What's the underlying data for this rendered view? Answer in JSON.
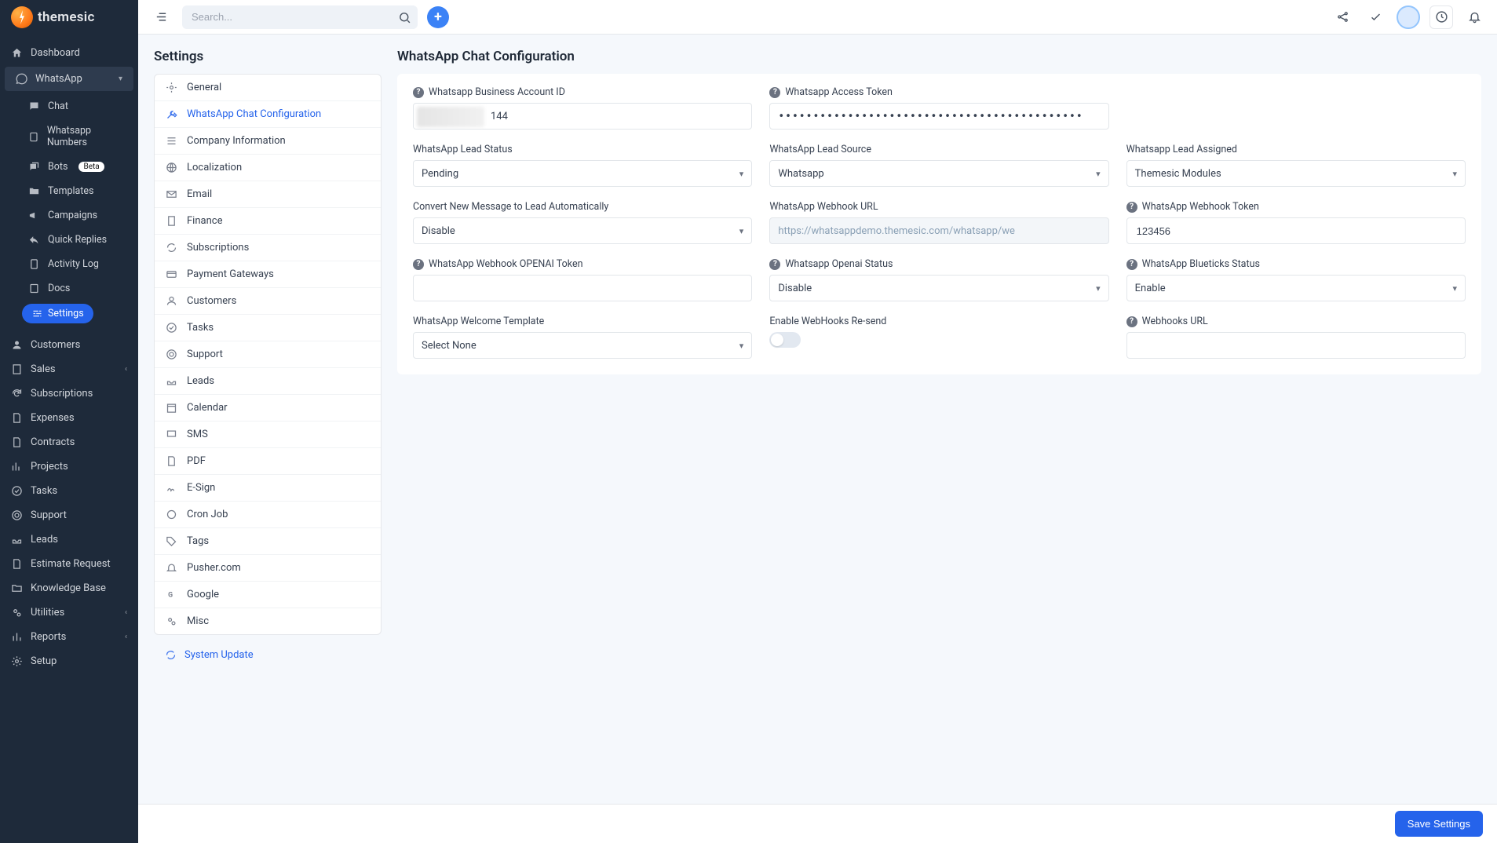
{
  "brand": {
    "name": "themesic"
  },
  "topbar": {
    "search_placeholder": "Search..."
  },
  "sidebar": {
    "items": {
      "dashboard": "Dashboard",
      "whatsapp": "WhatsApp",
      "customers": "Customers",
      "sales": "Sales",
      "subscriptions": "Subscriptions",
      "expenses": "Expenses",
      "contracts": "Contracts",
      "projects": "Projects",
      "tasks": "Tasks",
      "support": "Support",
      "leads": "Leads",
      "estimate_request": "Estimate Request",
      "knowledge_base": "Knowledge Base",
      "utilities": "Utilities",
      "reports": "Reports",
      "setup": "Setup"
    },
    "whatsapp_sub": {
      "chat": "Chat",
      "whatsapp_numbers": "Whatsapp Numbers",
      "bots": "Bots",
      "bots_badge": "Beta",
      "templates": "Templates",
      "campaigns": "Campaigns",
      "quick_replies": "Quick Replies",
      "activity_log": "Activity Log",
      "docs": "Docs",
      "settings": "Settings"
    }
  },
  "settings_panel": {
    "title": "Settings",
    "items": {
      "general": "General",
      "whatsapp_chat_configuration": "WhatsApp Chat Configuration",
      "company_information": "Company Information",
      "localization": "Localization",
      "email": "Email",
      "finance": "Finance",
      "subscriptions": "Subscriptions",
      "payment_gateways": "Payment Gateways",
      "customers": "Customers",
      "tasks": "Tasks",
      "support": "Support",
      "leads": "Leads",
      "calendar": "Calendar",
      "sms": "SMS",
      "pdf": "PDF",
      "esign": "E-Sign",
      "cron_job": "Cron Job",
      "tags": "Tags",
      "pusher": "Pusher.com",
      "google": "Google",
      "misc": "Misc"
    },
    "system_update": "System Update"
  },
  "config": {
    "title": "WhatsApp Chat Configuration",
    "labels": {
      "business_account_id": "Whatsapp Business Account ID",
      "access_token": "Whatsapp Access Token",
      "lead_status": "WhatsApp Lead Status",
      "lead_source": "WhatsApp Lead Source",
      "lead_assigned": "Whatsapp Lead Assigned",
      "convert_new_message": "Convert New Message to Lead Automatically",
      "webhook_url": "WhatsApp Webhook URL",
      "webhook_token": "WhatsApp Webhook Token",
      "openai_token": "WhatsApp Webhook OPENAI Token",
      "openai_status": "Whatsapp Openai Status",
      "blueticks_status": "WhatsApp Blueticks Status",
      "welcome_template": "WhatsApp Welcome Template",
      "webhooks_resend": "Enable WebHooks Re-send",
      "webhooks_url": "Webhooks URL"
    },
    "values": {
      "business_account_id_suffix": "144",
      "access_token_masked": "••••••••••••••••••••••••••••••••••••••••••••",
      "lead_status": "Pending",
      "lead_source": "Whatsapp",
      "lead_assigned": "Themesic Modules",
      "convert_new_message": "Disable",
      "webhook_url": "https://whatsappdemo.themesic.com/whatsapp/we",
      "webhook_token": "123456",
      "openai_token": "",
      "openai_status": "Disable",
      "blueticks_status": "Enable",
      "welcome_template": "Select None",
      "webhooks_resend": false,
      "webhooks_url": ""
    }
  },
  "footer": {
    "save": "Save Settings"
  }
}
